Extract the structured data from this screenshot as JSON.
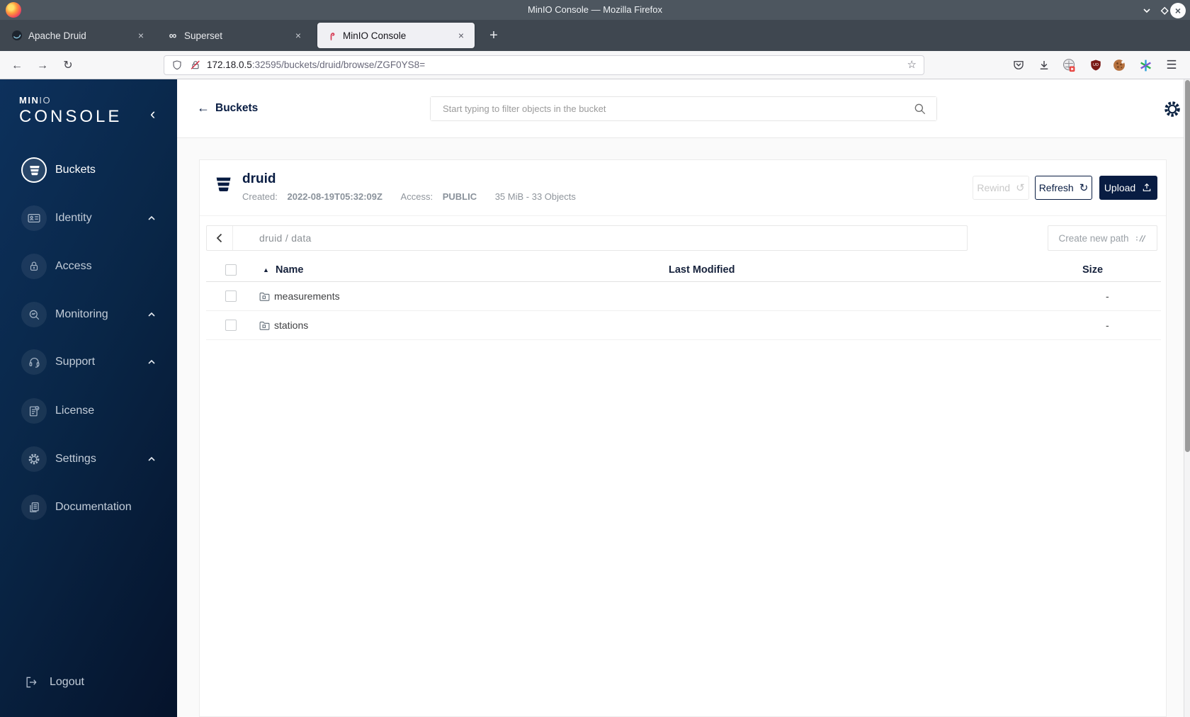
{
  "window": {
    "title": "MinIO Console — Mozilla Firefox"
  },
  "browser": {
    "tabs": [
      {
        "label": "Apache Druid",
        "icon": "druid-logo",
        "active": false
      },
      {
        "label": "Superset",
        "icon": "superset-logo",
        "active": false
      },
      {
        "label": "MinIO Console",
        "icon": "minio-flamingo-logo",
        "active": true
      }
    ],
    "url": {
      "host": "172.18.0.5",
      "rest": ":32595/buckets/druid/browse/ZGF0YS8="
    }
  },
  "glyphs": {
    "back_arrow": "←",
    "forward_arrow": "→",
    "reload": "↻",
    "star": "☆",
    "hamburger": "☰",
    "superset_infinity": "∞",
    "new_tab_plus": "+",
    "tab_close": "×",
    "window_close": "×",
    "collapse_chevron": "‹",
    "sort_asc": "▲",
    "refresh_cw": "↻",
    "rewind_ccw": "↺"
  },
  "sidebar": {
    "brand": {
      "min": "MIN",
      "io": "IO",
      "console": "CONSOLE"
    },
    "items": [
      {
        "label": "Buckets",
        "icon": "bucket-icon",
        "active": true,
        "chevron": false
      },
      {
        "label": "Identity",
        "icon": "id-card-icon",
        "active": false,
        "chevron": true
      },
      {
        "label": "Access",
        "icon": "access-lock-icon",
        "active": false,
        "chevron": false
      },
      {
        "label": "Monitoring",
        "icon": "monitoring-magnifier-icon",
        "active": false,
        "chevron": true
      },
      {
        "label": "Support",
        "icon": "support-headset-icon",
        "active": false,
        "chevron": true
      },
      {
        "label": "License",
        "icon": "license-doc-icon",
        "active": false,
        "chevron": false
      },
      {
        "label": "Settings",
        "icon": "gear-icon",
        "active": false,
        "chevron": true
      },
      {
        "label": "Documentation",
        "icon": "documentation-icon",
        "active": false,
        "chevron": false
      }
    ],
    "logout": {
      "label": "Logout",
      "icon": "logout-icon"
    }
  },
  "appheader": {
    "back_label": "Buckets",
    "search_placeholder": "Start typing to filter objects in the bucket"
  },
  "bucket": {
    "name": "druid",
    "created_label": "Created:",
    "created_value": "2022-08-19T05:32:09Z",
    "access_label": "Access:",
    "access_value": "PUBLIC",
    "summary": "35 MiB - 33 Objects",
    "buttons": {
      "rewind": "Rewind",
      "refresh": "Refresh",
      "upload": "Upload"
    }
  },
  "browse": {
    "breadcrumb": "druid / data",
    "create_path_label": "Create new path"
  },
  "table": {
    "columns": {
      "name": "Name",
      "modified": "Last Modified",
      "size": "Size"
    },
    "rows": [
      {
        "name": "measurements",
        "size": "-"
      },
      {
        "name": "stations",
        "size": "-"
      }
    ]
  },
  "colors": {
    "brand_navy": "#081C42",
    "sidebar_gradient_start": "#0d315c",
    "sidebar_gradient_end": "#05132b",
    "titlebar": "#4d565f",
    "accent_red_flamingo": "#d63a54"
  }
}
